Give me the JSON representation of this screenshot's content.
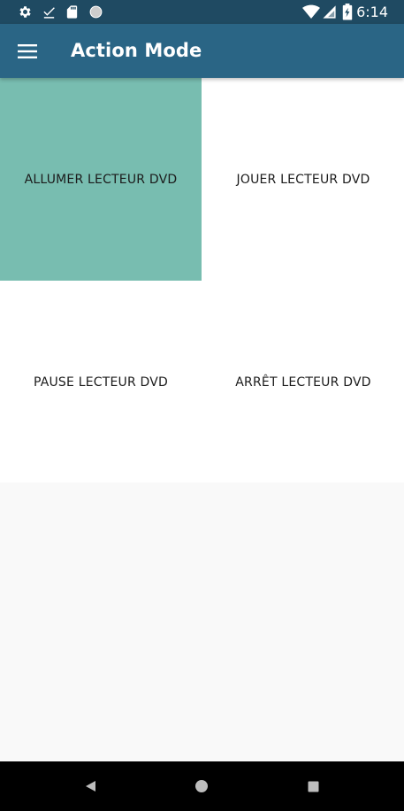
{
  "status_bar": {
    "time": "6:14",
    "icons": [
      "settings-icon",
      "download-done-icon",
      "sd-card-icon",
      "sync-circle-icon",
      "wifi-icon",
      "signal-icon",
      "battery-charging-icon"
    ]
  },
  "app_bar": {
    "title": "Action Mode",
    "menu_icon": "hamburger-menu-icon"
  },
  "grid": {
    "tiles": [
      {
        "label": "ALLUMER LECTEUR DVD",
        "selected": true
      },
      {
        "label": "JOUER LECTEUR DVD",
        "selected": false
      },
      {
        "label": "PAUSE LECTEUR DVD",
        "selected": false
      },
      {
        "label": "ARRÊT LECTEUR DVD",
        "selected": false
      }
    ]
  },
  "nav_bar": {
    "buttons": [
      "back-icon",
      "home-icon",
      "recents-icon"
    ]
  },
  "colors": {
    "status_bar": "#1f4a62",
    "app_bar": "#2a6585",
    "selected_tile": "#78bdb0",
    "background": "#f9f9f9"
  }
}
